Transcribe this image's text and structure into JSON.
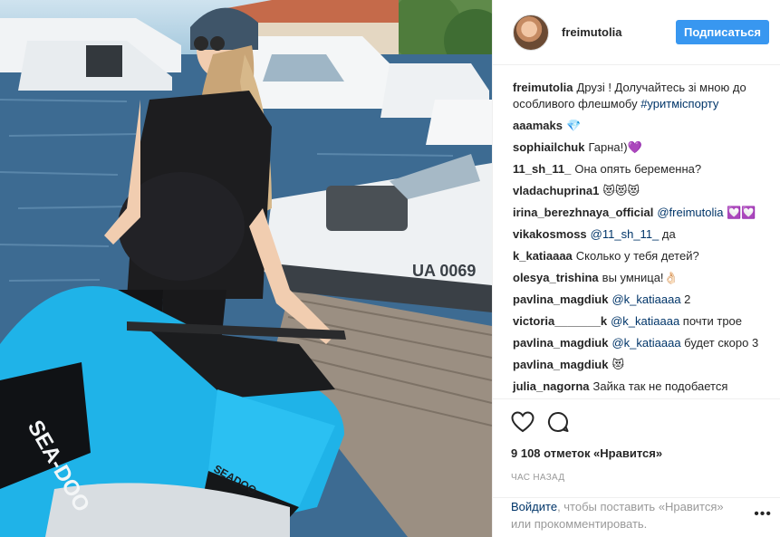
{
  "post": {
    "username": "freimutolia",
    "follow_label": "Подписаться"
  },
  "photo": {
    "jetski_brand": "SEA-DOO",
    "jetski_brand_small": "SEADOO",
    "boat_reg": "UA 0069"
  },
  "comments": [
    {
      "user": "freimutolia",
      "text": "Друзі ! Долучайтесь зі мною до особливого флешмобу ",
      "mention": "#уритміспорту"
    },
    {
      "user": "aaamaks",
      "text": "💎"
    },
    {
      "user": "sophiailchuk",
      "text": "Гарна!)💜"
    },
    {
      "user": "11_sh_11_",
      "text": "Она опять беременна?"
    },
    {
      "user": "vladachuprina1",
      "text": "😻😻😻"
    },
    {
      "user": "irina_berezhnaya_official",
      "mention": "@freimutolia",
      "text": " 💟💟"
    },
    {
      "user": "vikakosmoss",
      "mention": "@11_sh_11_",
      "text": " да"
    },
    {
      "user": "k_katiaaaa",
      "text": "Сколько у тебя детей?"
    },
    {
      "user": "olesya_trishina",
      "text": "вы умница!👌🏻"
    },
    {
      "user": "pavlina_magdiuk",
      "mention": "@k_katiaaaa",
      "text": " 2"
    },
    {
      "user": "victoria_______k",
      "mention": "@k_katiaaaa",
      "text": " почти трое"
    },
    {
      "user": "pavlina_magdiuk",
      "mention": "@k_katiaaaa",
      "text": " будет скоро 3"
    },
    {
      "user": "pavlina_magdiuk",
      "text": "😻"
    },
    {
      "user": "julia_nagorna",
      "text": "Зайка так не подобается"
    }
  ],
  "likes": "9 108 отметок «Нравится»",
  "time": "ЧАС НАЗАД",
  "login": {
    "link": "Войдите",
    "text": ", чтобы поставить «Нравится» или прокомментировать."
  },
  "icons": {
    "like": "heart-icon",
    "comment": "comment-icon",
    "more": "more-options-icon"
  },
  "colors": {
    "accent": "#3897f0",
    "mention": "#003569",
    "jetski": "#1fb3e8"
  }
}
